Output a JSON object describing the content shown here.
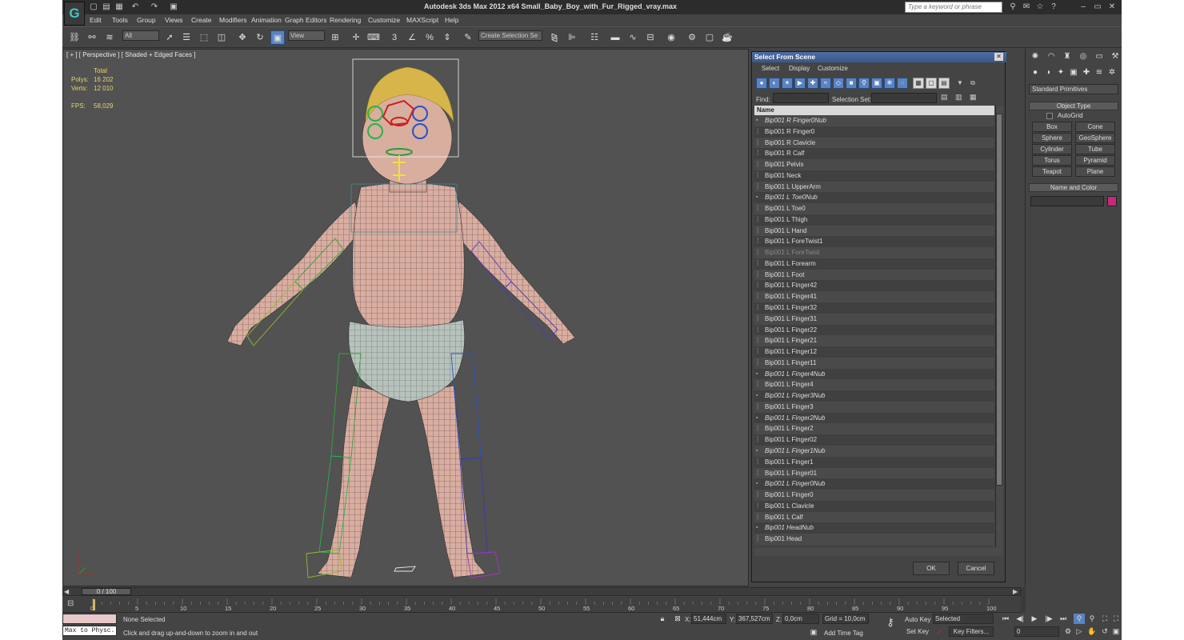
{
  "window": {
    "title": "Autodesk 3ds Max  2012 x64      Small_Baby_Boy_with_Fur_Rigged_vray.max",
    "search_placeholder": "Type a keyword or phrase"
  },
  "menu": [
    "Edit",
    "Tools",
    "Group",
    "Views",
    "Create",
    "Modifiers",
    "Animation",
    "Graph Editors",
    "Rendering",
    "Customize",
    "MAXScript",
    "Help"
  ],
  "toolbar": {
    "filter": "All",
    "refcoord": "View",
    "selection_set": "Create Selection Se"
  },
  "viewport": {
    "label": "[ + ] [ Perspective ] [ Shaded + Edged Faces ]",
    "stats": {
      "total_label": "Total",
      "polys_label": "Polys:",
      "polys": "16 202",
      "verts_label": "Verts:",
      "verts": "12 010",
      "fps_label": "FPS:",
      "fps": "58,029"
    }
  },
  "dialog": {
    "title": "Select From Scene",
    "menus": [
      "Select",
      "Display",
      "Customize"
    ],
    "find_label": "Find:",
    "selset_label": "Selection Set:",
    "column": "Name",
    "ok": "OK",
    "cancel": "Cancel",
    "items": [
      {
        "name": "Bip001 R Finger0Nub",
        "italic": true
      },
      {
        "name": "Bip001 R Finger0"
      },
      {
        "name": "Bip001 R Clavicle"
      },
      {
        "name": "Bip001 R Calf"
      },
      {
        "name": "Bip001 Pelvis"
      },
      {
        "name": "Bip001 Neck"
      },
      {
        "name": "Bip001 L UpperArm"
      },
      {
        "name": "Bip001 L Toe0Nub",
        "italic": true
      },
      {
        "name": "Bip001 L Toe0"
      },
      {
        "name": "Bip001 L Thigh"
      },
      {
        "name": "Bip001 L Hand"
      },
      {
        "name": "Bip001 L ForeTwist1"
      },
      {
        "name": "Bip001 L ForeTwist",
        "dim": true
      },
      {
        "name": "Bip001 L Forearm"
      },
      {
        "name": "Bip001 L Foot"
      },
      {
        "name": "Bip001 L Finger42"
      },
      {
        "name": "Bip001 L Finger41"
      },
      {
        "name": "Bip001 L Finger32"
      },
      {
        "name": "Bip001 L Finger31"
      },
      {
        "name": "Bip001 L Finger22"
      },
      {
        "name": "Bip001 L Finger21"
      },
      {
        "name": "Bip001 L Finger12"
      },
      {
        "name": "Bip001 L Finger11"
      },
      {
        "name": "Bip001 L Finger4Nub",
        "italic": true
      },
      {
        "name": "Bip001 L Finger4"
      },
      {
        "name": "Bip001 L Finger3Nub",
        "italic": true
      },
      {
        "name": "Bip001 L Finger3"
      },
      {
        "name": "Bip001 L Finger2Nub",
        "italic": true
      },
      {
        "name": "Bip001 L Finger2"
      },
      {
        "name": "Bip001 L Finger02"
      },
      {
        "name": "Bip001 L Finger1Nub",
        "italic": true
      },
      {
        "name": "Bip001 L Finger1"
      },
      {
        "name": "Bip001 L Finger01"
      },
      {
        "name": "Bip001 L Finger0Nub",
        "italic": true
      },
      {
        "name": "Bip001 L Finger0"
      },
      {
        "name": "Bip001 L Clavicle"
      },
      {
        "name": "Bip001 L Calf"
      },
      {
        "name": "Bip001 HeadNub",
        "italic": true
      },
      {
        "name": "Bip001 Head"
      }
    ]
  },
  "command_panel": {
    "category": "Standard Primitives",
    "object_type_title": "Object Type",
    "autogrid": "AutoGrid",
    "buttons": [
      "Box",
      "Cone",
      "Sphere",
      "GeoSphere",
      "Cylinder",
      "Tube",
      "Torus",
      "Pyramid",
      "Teapot",
      "Plane"
    ],
    "name_color_title": "Name and Color",
    "color": "#c8287a"
  },
  "timeline": {
    "slider": "0 / 100",
    "ticks": [
      "0",
      "5",
      "10",
      "15",
      "20",
      "25",
      "30",
      "35",
      "40",
      "45",
      "50",
      "55",
      "60",
      "65",
      "70",
      "75",
      "80",
      "85",
      "90",
      "95",
      "100"
    ]
  },
  "status": {
    "listener": "Max to Physc.",
    "selection": "None Selected",
    "prompt": "Click and drag up-and-down to zoom in and out",
    "x_label": "X:",
    "x": "51,444cm",
    "y_label": "Y:",
    "y": "367,527cm",
    "z_label": "Z:",
    "z": "0,0cm",
    "grid": "Grid = 10,0cm",
    "add_time_tag": "Add Time Tag",
    "auto_key": "Auto Key",
    "auto_key_mode": "Selected",
    "set_key": "Set Key",
    "key_filters": "Key Filters...",
    "frame": "0"
  },
  "colors": {
    "accent": "#5a83c2",
    "skin": "#dcb2a3",
    "hair": "#d7b54a"
  }
}
